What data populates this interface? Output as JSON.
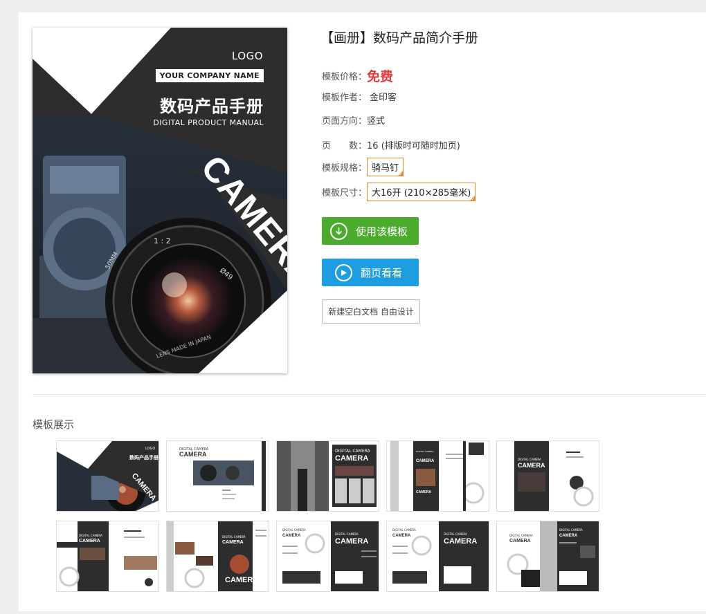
{
  "template": {
    "title": "【画册】数码产品简介手册",
    "rows": [
      {
        "label": "模板价格：",
        "value": "免费"
      },
      {
        "label": "模板作者：",
        "value": "金印客"
      },
      {
        "label": "页面方向：",
        "value": "竖式"
      },
      {
        "label": "页　　数：",
        "value": "16 (排版时可随时加页)"
      },
      {
        "label": "模板规格：",
        "value": "骑马钉"
      },
      {
        "label": "模板尺寸：",
        "value": "大16开 (210×285毫米)"
      }
    ],
    "buttons": {
      "use": "使用该模板",
      "flip": "翻页看看",
      "blank": "新建空白文档 自由设计"
    }
  },
  "cover": {
    "logo": "LOGO",
    "company": "YOUR COMPANY NAME",
    "cn_title": "数码产品手册",
    "en_title": "DIGITAL PRODUCT MANUAL",
    "camera": "CAMERA",
    "lens_text_1": "1 : 2",
    "lens_text_2": "50MM",
    "lens_text_3": "Ø49",
    "lens_text_4": "LENS MADE IN JAPAN"
  },
  "showcase": {
    "label": "模板展示",
    "thumb_texts": {
      "camera": "CAMERA",
      "digital_camera": "DIGITAL CAMERA",
      "logo": "LOGO"
    }
  },
  "colors": {
    "price": "#e4393c",
    "green": "#4aab2d",
    "blue": "#1e9ee0",
    "tag": "#e08a2a",
    "dark": "#2d2d2d"
  }
}
